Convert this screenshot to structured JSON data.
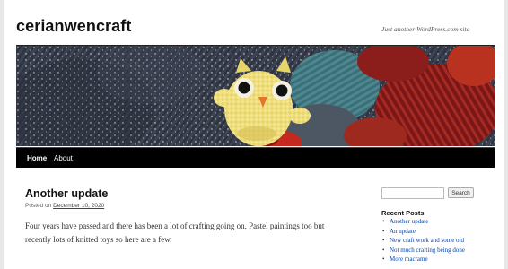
{
  "site": {
    "title": "cerianwencraft",
    "description": "Just another WordPress.com site"
  },
  "nav": {
    "items": [
      {
        "label": "Home",
        "active": true
      },
      {
        "label": "About",
        "active": false
      }
    ]
  },
  "post": {
    "title": "Another update",
    "meta_prefix": "Posted on",
    "date": "December 10, 2020",
    "body": "Four years have passed and there has been a lot of crafting going on. Pastel paintings too but recently lots of knitted toys so here are a few."
  },
  "sidebar": {
    "search_button": "Search",
    "recent_posts_title": "Recent Posts",
    "recent_posts": [
      "Another update",
      "An update",
      "New craft work and some old",
      "Not much crafting being done",
      "More macrame"
    ]
  },
  "colors": {
    "nav_background": "#000000",
    "link": "#0645ad"
  }
}
